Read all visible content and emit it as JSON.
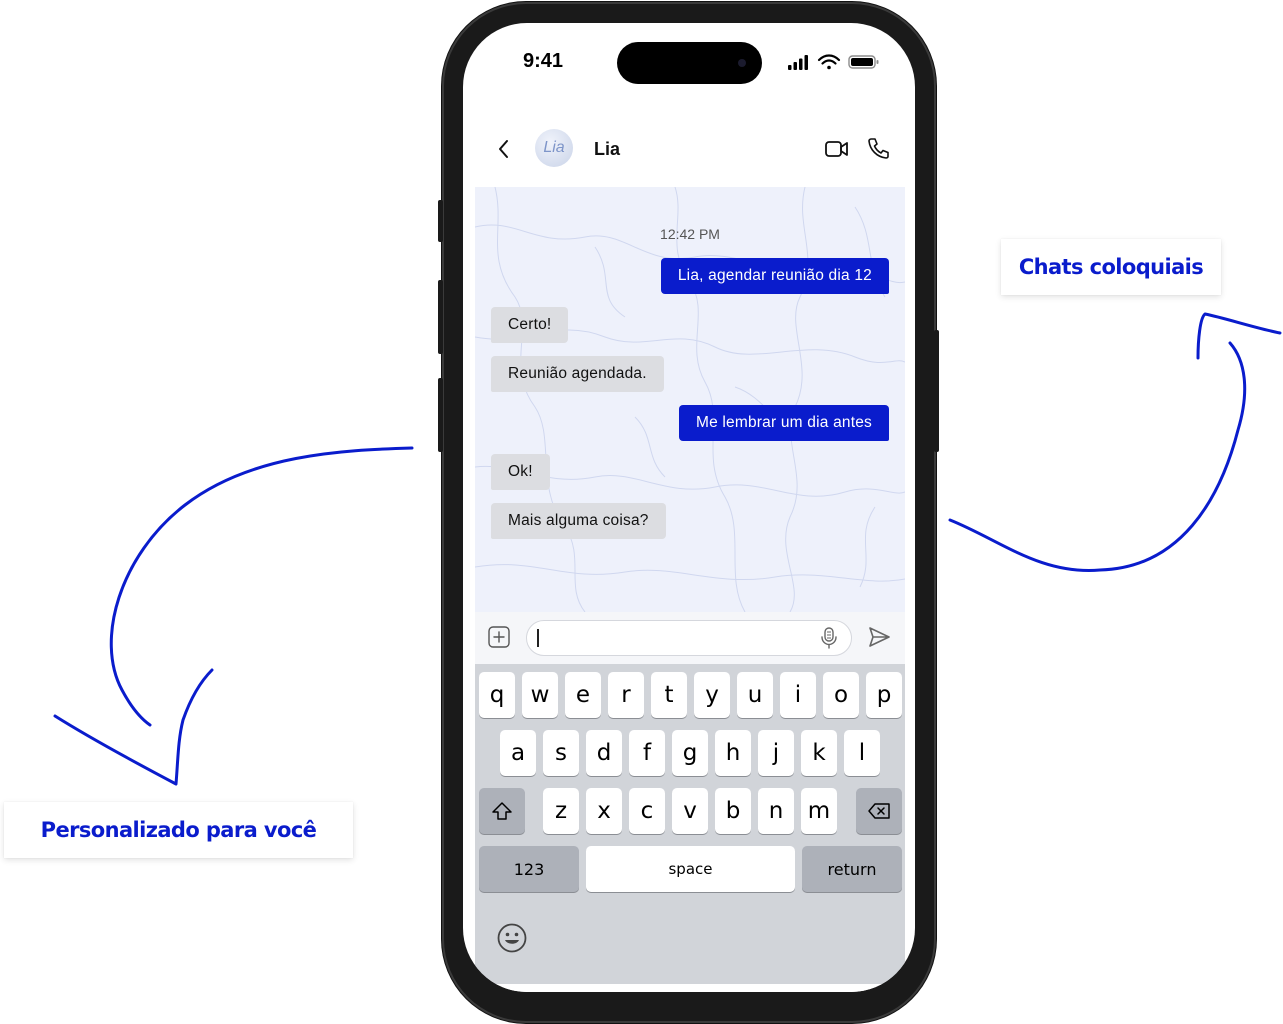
{
  "callouts": {
    "chats": "Chats coloquiais",
    "personal": "Personalizado para você"
  },
  "status_bar": {
    "time": "9:41"
  },
  "header": {
    "avatar_text": "Lia",
    "contact_name": "Lia"
  },
  "chat": {
    "timestamp": "12:42 PM",
    "messages": [
      {
        "direction": "out",
        "text": "Lia, agendar reunião dia 12"
      },
      {
        "direction": "in",
        "text": "Certo!"
      },
      {
        "direction": "in",
        "text": "Reunião agendada."
      },
      {
        "direction": "out",
        "text": "Me lembrar um dia antes"
      },
      {
        "direction": "in",
        "text": "Ok!"
      },
      {
        "direction": "in",
        "text": "Mais alguma coisa?"
      }
    ]
  },
  "composer": {
    "value": ""
  },
  "keyboard": {
    "row1": [
      "q",
      "w",
      "e",
      "r",
      "t",
      "y",
      "u",
      "i",
      "o",
      "p"
    ],
    "row2": [
      "a",
      "s",
      "d",
      "f",
      "g",
      "h",
      "j",
      "k",
      "l"
    ],
    "row3": [
      "z",
      "x",
      "c",
      "v",
      "b",
      "n",
      "m"
    ],
    "numbers_label": "123",
    "space_label": "space",
    "return_label": "return"
  },
  "colors": {
    "accent": "#0a1ccc",
    "incoming_bubble": "#dcdde1",
    "chat_background": "#eef1fb",
    "keyboard_background": "#d1d4d9"
  },
  "icons": [
    "back-arrow-icon",
    "video-camera-icon",
    "phone-icon",
    "plus-icon",
    "microphone-icon",
    "send-icon",
    "shift-icon",
    "backspace-icon",
    "emoji-icon",
    "signal-icon",
    "wifi-icon",
    "battery-icon"
  ]
}
